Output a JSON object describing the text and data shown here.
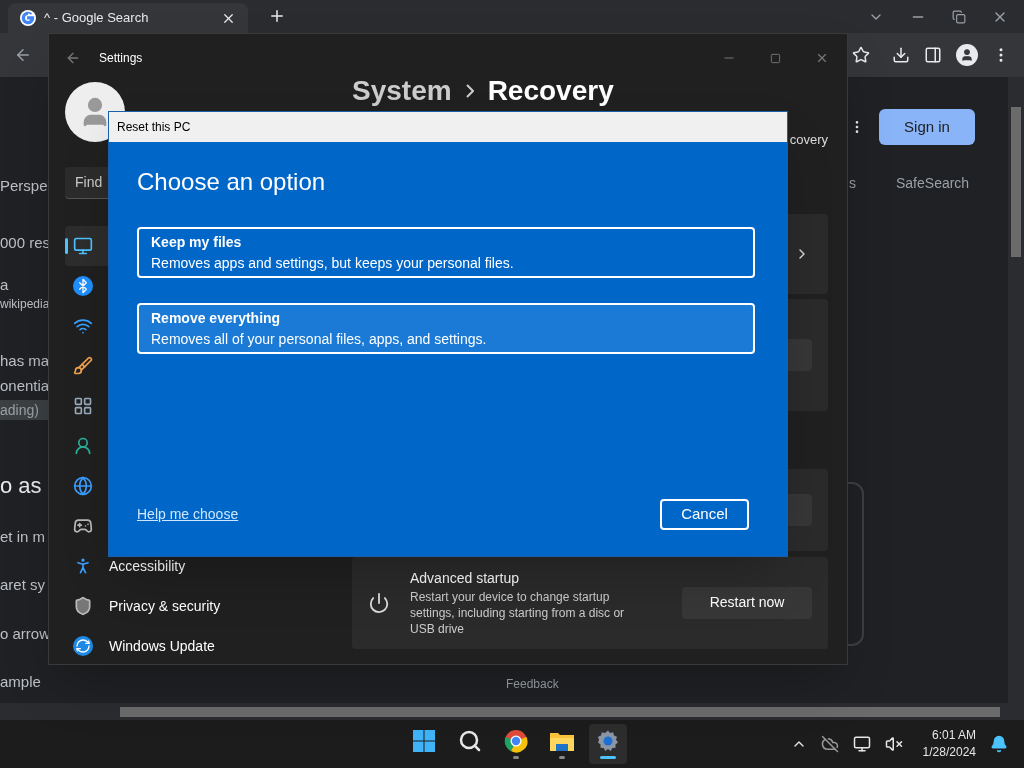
{
  "browser": {
    "tab": {
      "title": "^ - Google Search",
      "selected": true
    },
    "page_fragments": [
      {
        "kind": "text",
        "text": "Perspe"
      },
      {
        "kind": "text",
        "text": "000 res"
      },
      {
        "kind": "text",
        "text": "a"
      },
      {
        "kind": "small",
        "text": "wikipedia"
      },
      {
        "kind": "text",
        "text": "has ma"
      },
      {
        "kind": "text",
        "text": "onentia"
      },
      {
        "kind": "chip",
        "text": "ading)"
      },
      {
        "kind": "heading",
        "text": "o as"
      },
      {
        "kind": "text",
        "text": "et in m"
      },
      {
        "kind": "text",
        "text": "aret sy"
      },
      {
        "kind": "text",
        "text": "o arrow"
      },
      {
        "kind": "text",
        "text": "ample"
      }
    ],
    "right": {
      "sign_in": "Sign in",
      "tab_fragment": "s",
      "safesearch": "SafeSearch"
    },
    "feedback": "Feedback"
  },
  "settings": {
    "title": "Settings",
    "search_placeholder": "Find",
    "breadcrumb": [
      "System",
      "Recovery"
    ],
    "subtitle_fragment": "covery",
    "nav": [
      {
        "kind": "display",
        "selected": true
      },
      {
        "kind": "bluetooth",
        "selected": false
      },
      {
        "kind": "wifi",
        "selected": false
      },
      {
        "kind": "brush",
        "selected": false
      },
      {
        "kind": "apps",
        "selected": false
      },
      {
        "kind": "account",
        "selected": false
      },
      {
        "kind": "time",
        "selected": false
      },
      {
        "kind": "gaming",
        "selected": false
      },
      {
        "kind": "accessibility",
        "label": "Accessibility",
        "selected": false
      },
      {
        "kind": "privacy",
        "label": "Privacy & security",
        "selected": false
      },
      {
        "kind": "update",
        "label": "Windows Update",
        "selected": false
      }
    ],
    "advanced_startup": {
      "title": "Advanced startup",
      "description": "Restart your device to change startup settings, including starting from a disc or USB drive",
      "button": "Restart now"
    }
  },
  "dialog": {
    "title": "Reset this PC",
    "heading": "Choose an option",
    "options": [
      {
        "title": "Keep my files",
        "description": "Removes apps and settings, but keeps your personal files.",
        "hovered": false
      },
      {
        "title": "Remove everything",
        "description": "Removes all of your personal files, apps, and settings.",
        "hovered": true
      }
    ],
    "help_link": "Help me choose",
    "cancel": "Cancel"
  },
  "taskbar": {
    "apps": [
      {
        "kind": "start",
        "running": false,
        "active": false
      },
      {
        "kind": "search",
        "running": false,
        "active": false
      },
      {
        "kind": "browser",
        "running": true,
        "active": false
      },
      {
        "kind": "explorer",
        "running": true,
        "active": false
      },
      {
        "kind": "settings",
        "running": true,
        "active": true
      }
    ],
    "time": "6:01 AM",
    "date": "1/28/2024"
  }
}
